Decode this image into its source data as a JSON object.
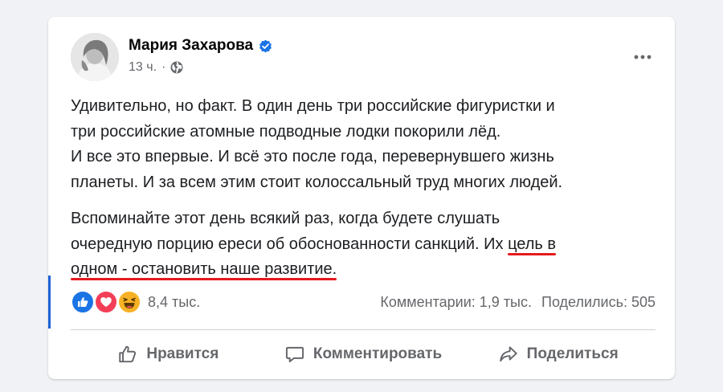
{
  "post": {
    "author_name": "Мария Захарова",
    "timestamp": "13 ч.",
    "separator": "·",
    "icons": {
      "verified": "verified-badge-icon",
      "privacy": "globe-icon",
      "more": "more-options-icon"
    },
    "text": {
      "line1": "Удивительно, но факт. В один день три российские фигуристки и",
      "line2": "три российские атомные подводные лодки покорили лёд.",
      "line3": "И все это впервые. И всё это после года, перевернувшего жизнь",
      "line4": "планеты. И за всем этим стоит колоссальный  труд многих людей.",
      "para2_line1": "Вспоминайте этот день всякий раз, когда будете слушать",
      "para2_line2_plain": "очередную порцию ереси об обоснованности санкций. Их ",
      "para2_line2_hl": "цель в",
      "para2_line3_hl": "одном - остановить наше развитие."
    }
  },
  "stats": {
    "reactions": [
      "like",
      "love",
      "haha"
    ],
    "reaction_count": "8,4 тыс.",
    "comments": "Комментарии: 1,9 тыс.",
    "shares": "Поделились: 505"
  },
  "actions": {
    "like_label": "Нравится",
    "comment_label": "Комментировать",
    "share_label": "Поделиться"
  },
  "colors": {
    "brand_blue": "#1b74e4",
    "love_red": "#f33e58",
    "haha_yellow": "#f7b125",
    "underline_red": "#e51a1f",
    "secondary_text": "#65676b"
  }
}
